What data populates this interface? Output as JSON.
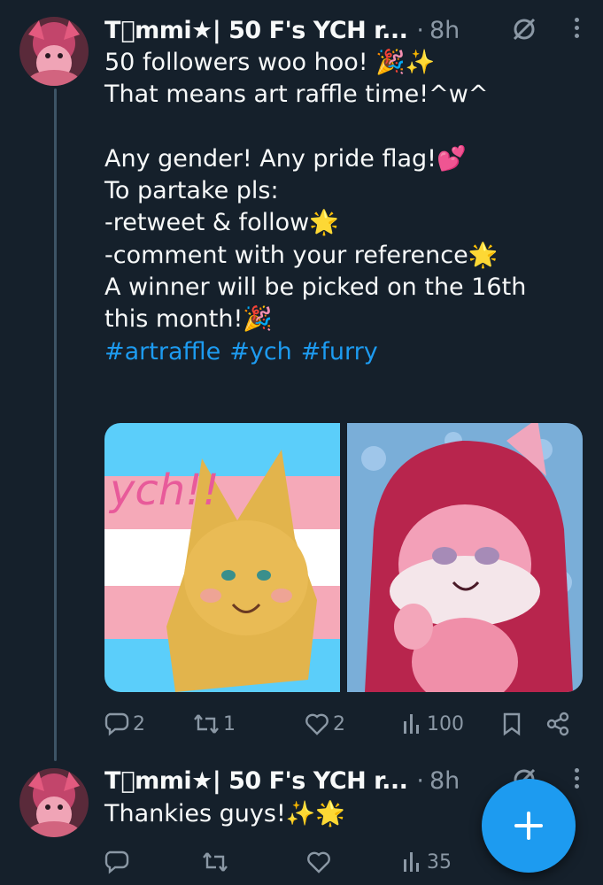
{
  "tweets": [
    {
      "display_name": "T⃠mmi★| 50 F's YCH r...",
      "separator": "·",
      "time": "8h",
      "text_lines": [
        "50 followers woo hoo! 🎉✨",
        "That means art raffle time!^w^",
        "",
        "Any gender! Any pride flag!💕",
        "To partake pls:",
        "-retweet & follow🌟",
        "-comment with your reference🌟",
        "A winner will be picked on the 16th",
        "this month!🎉"
      ],
      "hashtags": [
        "#artraffle",
        "#ych",
        "#furry"
      ],
      "media": [
        {
          "icon": "ych-trans-flag-fox-image",
          "overlay_text": "ych!!"
        },
        {
          "icon": "pink-fox-character-image"
        }
      ],
      "actions": {
        "replies": "2",
        "retweets": "1",
        "likes": "2",
        "views": "100"
      }
    },
    {
      "display_name": "T⃠mmi★| 50 F's YCH r...",
      "separator": "·",
      "time": "8h",
      "text": "Thankies guys!✨🌟",
      "actions": {
        "replies": "",
        "retweets": "",
        "likes": "",
        "views": "35"
      }
    }
  ],
  "colors": {
    "background": "#15202b",
    "accent": "#1d9bf0",
    "muted": "#8b98a5",
    "text": "#f7f9f9"
  },
  "fab": {
    "icon": "plus-icon"
  }
}
